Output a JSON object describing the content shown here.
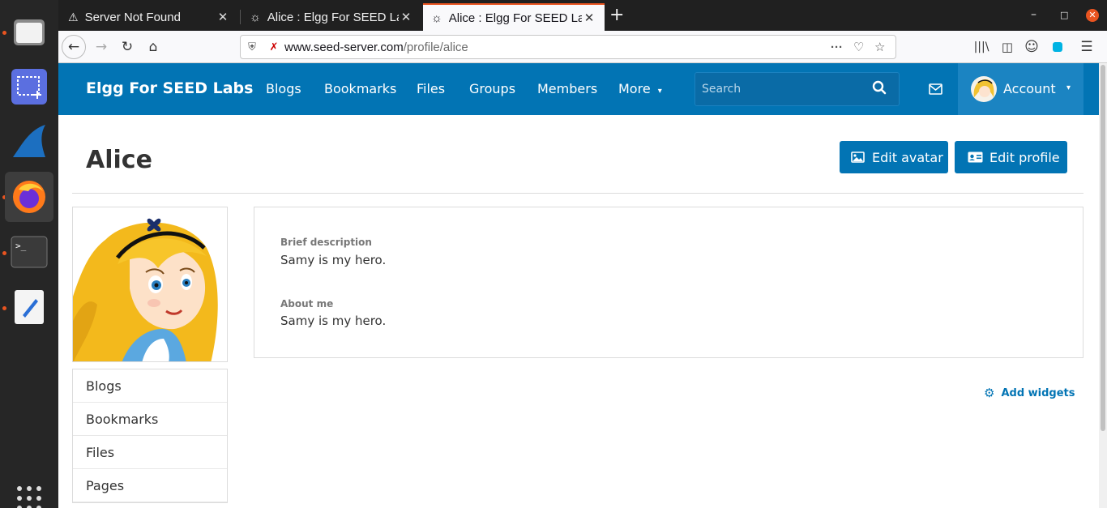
{
  "browser": {
    "tabs": [
      {
        "label": "Server Not Found"
      },
      {
        "label": "Alice : Elgg For SEED Labs"
      },
      {
        "label": "Alice : Elgg For SEED Labs"
      }
    ],
    "url_host": "www.seed-server.com",
    "url_path": "/profile/alice"
  },
  "site": {
    "brand": "Elgg For SEED Labs",
    "nav": [
      "Blogs",
      "Bookmarks",
      "Files",
      "Groups",
      "Members",
      "More"
    ],
    "search_placeholder": "Search",
    "account_label": "Account",
    "accent_color": "#0274b4"
  },
  "profile": {
    "name": "Alice",
    "edit_avatar": "Edit avatar",
    "edit_profile": "Edit profile",
    "fields": [
      {
        "label": "Brief description",
        "value": "Samy is my hero."
      },
      {
        "label": "About me",
        "value": "Samy is my hero."
      }
    ],
    "side_menu": [
      "Blogs",
      "Bookmarks",
      "Files",
      "Pages"
    ],
    "add_widgets": "Add widgets"
  }
}
